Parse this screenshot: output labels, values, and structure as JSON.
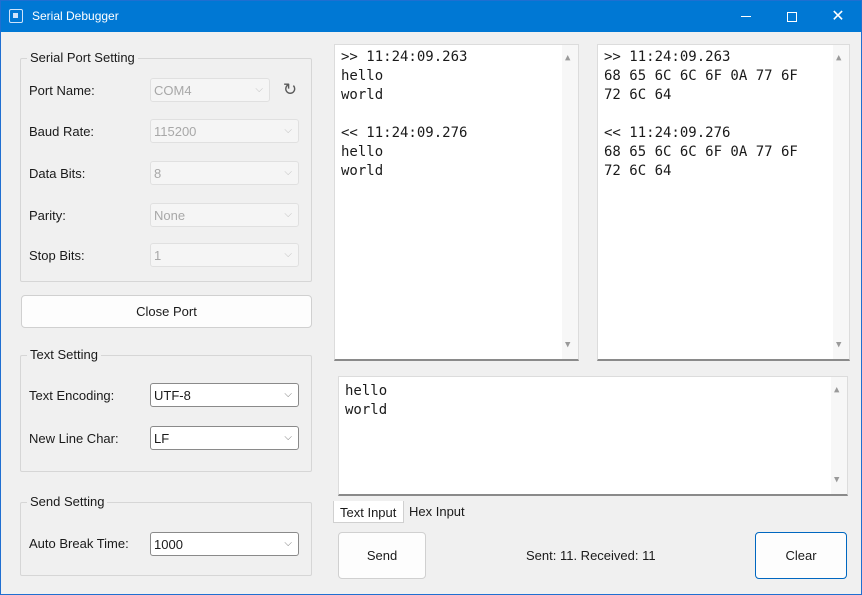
{
  "window": {
    "title": "Serial Debugger"
  },
  "serial_port": {
    "group_title": "Serial Port Setting",
    "port_name_label": "Port Name:",
    "port_name_value": "COM4",
    "baud_rate_label": "Baud Rate:",
    "baud_rate_value": "115200",
    "data_bits_label": "Data Bits:",
    "data_bits_value": "8",
    "parity_label": "Parity:",
    "parity_value": "None",
    "stop_bits_label": "Stop Bits:",
    "stop_bits_value": "1"
  },
  "port_button_label": "Close Port",
  "text_setting": {
    "group_title": "Text Setting",
    "encoding_label": "Text Encoding:",
    "encoding_value": "UTF-8",
    "newline_label": "New Line Char:",
    "newline_value": "LF"
  },
  "send_setting": {
    "group_title": "Send Setting",
    "auto_break_label": "Auto Break Time:",
    "auto_break_value": "1000"
  },
  "log_text": ">> 11:24:09.263\nhello\nworld\n\n<< 11:24:09.276\nhello\nworld",
  "log_hex": ">> 11:24:09.263\n68 65 6C 6C 6F 0A 77 6F\n72 6C 64\n\n<< 11:24:09.276\n68 65 6C 6C 6F 0A 77 6F\n72 6C 64",
  "input_text": "hello\nworld",
  "tabs": {
    "text_input": "Text Input",
    "hex_input": "Hex Input"
  },
  "send_button_label": "Send",
  "status_text": "Sent: 11. Received: 11",
  "clear_button_label": "Clear",
  "colors": {
    "titlebar": "#0078d4",
    "accent_border": "#0067c0"
  },
  "icons": {
    "refresh": "refresh-icon",
    "app": "app-icon",
    "chevron": "chevron-down-icon"
  }
}
